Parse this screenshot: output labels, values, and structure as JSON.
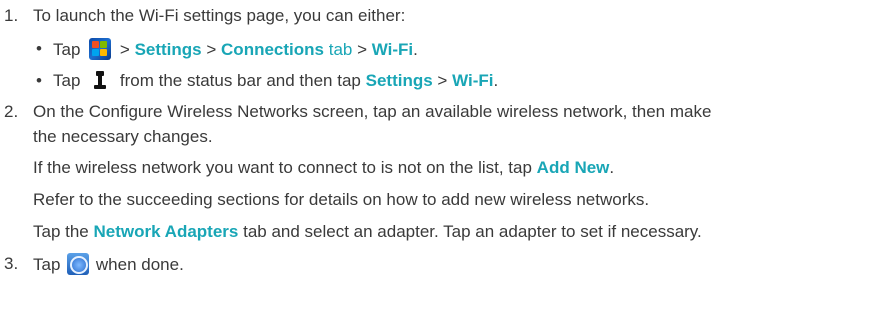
{
  "steps": {
    "s1": {
      "num": "1.",
      "text": "To launch the Wi-Fi settings page, you can either:"
    },
    "b1": {
      "bullet": "•",
      "tap": "Tap",
      "icon": "windows-start-icon",
      "sep1": ">",
      "settings": "Settings",
      "sep2": ">",
      "connections": "Connections",
      "tab": "tab",
      "sep3": ">",
      "wifi": "Wi-Fi",
      "period": "."
    },
    "b2": {
      "bullet": "•",
      "tap": "Tap",
      "icon": "signal-status-icon",
      "text": "from the status bar and then tap",
      "settings": "Settings",
      "sep": ">",
      "wifi": "Wi-Fi",
      "period": "."
    },
    "s2": {
      "num": "2.",
      "line1": "On the Configure Wireless Networks screen, tap an available wireless network, then make",
      "line2": "the necessary changes."
    },
    "p1": {
      "text": "If the wireless network you want to connect to is not on the list, tap",
      "add_new": "Add New",
      "period": "."
    },
    "p2": {
      "text": "Refer to the succeeding sections for details on how to add new wireless networks."
    },
    "p3": {
      "tap": "Tap the",
      "network_adapters": "Network Adapters",
      "rest": "tab and select an adapter. Tap an adapter to set if necessary."
    },
    "s3": {
      "num": "3.",
      "tap": "Tap",
      "icon": "ok-icon",
      "text": "when done."
    }
  },
  "colors": {
    "text": "#3a3a3a",
    "highlight": "#19a6b6"
  }
}
